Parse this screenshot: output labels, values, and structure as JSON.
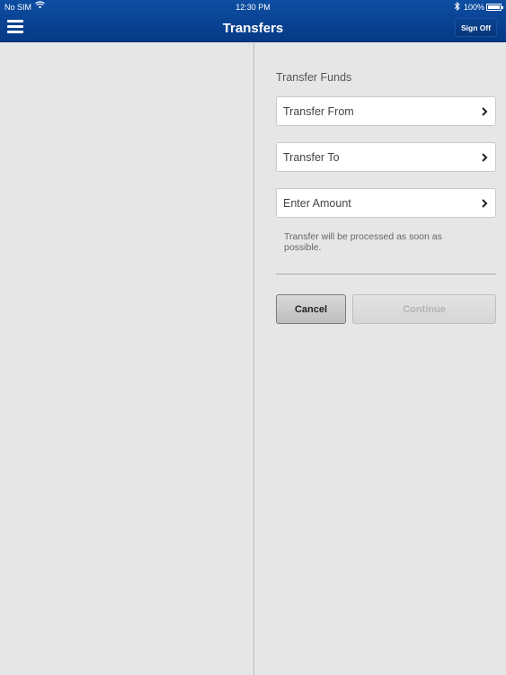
{
  "status_bar": {
    "carrier": "No SIM",
    "time": "12:30 PM",
    "battery": "100%"
  },
  "nav": {
    "title": "Transfers",
    "sign_off": "Sign Off"
  },
  "transfer": {
    "section_title": "Transfer Funds",
    "rows": [
      {
        "label": "Transfer From"
      },
      {
        "label": "Transfer To"
      },
      {
        "label": "Enter Amount"
      }
    ],
    "note": "Transfer will be processed as soon as possible.",
    "cancel_label": "Cancel",
    "continue_label": "Continue"
  },
  "colors": {
    "nav_bar": "#0a4493",
    "background": "#e6e6e6",
    "disabled_text": "#b3b3b3"
  }
}
